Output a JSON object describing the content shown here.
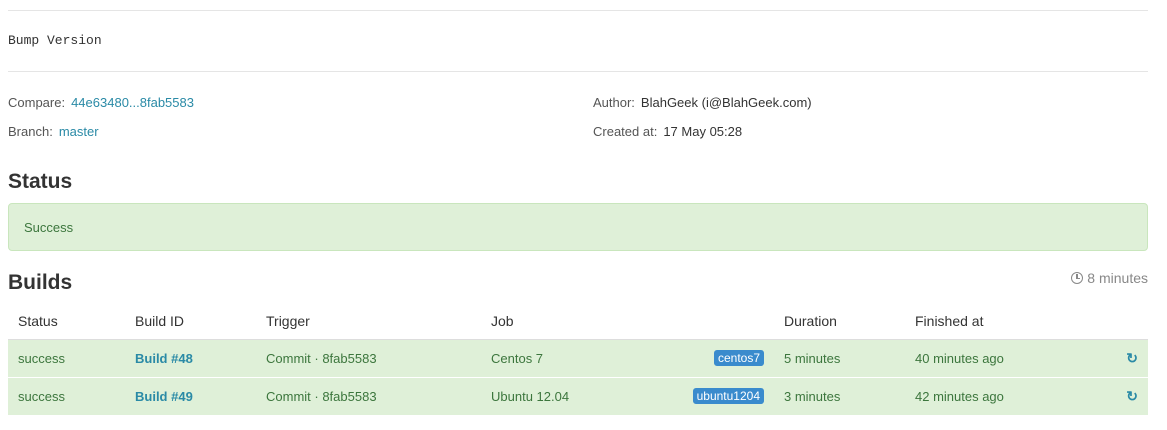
{
  "commit": {
    "message": "Bump Version"
  },
  "meta": {
    "compare_label": "Compare:",
    "compare_value": "44e63480...8fab5583",
    "branch_label": "Branch:",
    "branch_value": "master",
    "author_label": "Author:",
    "author_value": "BlahGeek (i@BlahGeek.com)",
    "created_label": "Created at:",
    "created_value": "17 May 05:28"
  },
  "status": {
    "heading": "Status",
    "text": "Success"
  },
  "builds": {
    "heading": "Builds",
    "total_duration": "8 minutes",
    "columns": [
      "Status",
      "Build ID",
      "Trigger",
      "Job",
      "Duration",
      "Finished at"
    ],
    "rows": [
      {
        "status": "success",
        "build_id": "Build #48",
        "trigger": "Commit · 8fab5583",
        "job": "Centos 7",
        "label": "centos7",
        "duration": "5 minutes",
        "finished": "40 minutes ago"
      },
      {
        "status": "success",
        "build_id": "Build #49",
        "trigger": "Commit · 8fab5583",
        "job": "Ubuntu 12.04",
        "label": "ubuntu1204",
        "duration": "3 minutes",
        "finished": "42 minutes ago"
      }
    ]
  },
  "colors": {
    "success_bg": "#dff0d8",
    "success_text": "#3c763d",
    "link": "#2a8aa6",
    "badge": "#3a8bcd"
  },
  "icons": {
    "clock": "clock-icon",
    "retry": "refresh-icon"
  }
}
